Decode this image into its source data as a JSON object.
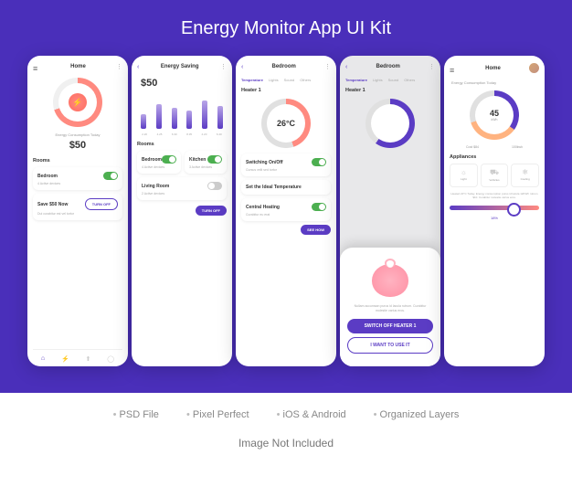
{
  "title": "Energy Monitor App UI Kit",
  "footer": {
    "feat": [
      "PSD File",
      "Pixel Perfect",
      "iOS & Android",
      "Organized Layers"
    ],
    "disclaimer": "Image Not Included"
  },
  "s1": {
    "title": "Home",
    "sub": "Energy Consumption Today",
    "price": "$50",
    "sec": "Rooms",
    "room": {
      "name": "Bedroom",
      "devices": "4 Active devices"
    },
    "save": {
      "title": "Save $50 Now",
      "sub": "Dui curabitur est vel tortor"
    },
    "turnoff": "TURN OFF"
  },
  "s2": {
    "title": "Energy Saving",
    "price": "$50",
    "sec": "Rooms",
    "rooms": [
      {
        "name": "Bedroom",
        "devices": "4 Active devices"
      },
      {
        "name": "Kitchen",
        "devices": "3 Active devices"
      },
      {
        "name": "Living Room",
        "devices": "2 Active devices"
      }
    ],
    "turnoff": "TURN OFF"
  },
  "s3": {
    "title": "Bedroom",
    "tabs": [
      "Temperature",
      "Lights",
      "Sound",
      "Others"
    ],
    "heater": "Heater 1",
    "temp": "26°C",
    "rows": [
      {
        "name": "Switching On/Off",
        "sub": "Cursus velit sed tortor"
      },
      {
        "name": "Set the Ideal Temperature",
        "sub": ""
      },
      {
        "name": "Central Heating",
        "sub": "Curabitur eu erat"
      }
    ],
    "see": "SEE HOW"
  },
  "s4": {
    "title": "Bedroom",
    "tabs": [
      "Temperature",
      "Lights",
      "Sound",
      "Others"
    ],
    "heater": "Heater 1",
    "lorem": "Nullam accumsan purus id lacula rutrum. Curabitur molestie varius eros.",
    "btn1": "SWITCH OFF HEATER 1",
    "btn2": "I WANT TO USE IT"
  },
  "s5": {
    "title": "Home",
    "sub": "Energy Consumption Today",
    "val": "45",
    "unit": "kWh",
    "stats": [
      "Cost $84",
      "100kwh"
    ],
    "sec": "Appliances",
    "appl": [
      "Light",
      "Vehicles",
      "Cooling"
    ],
    "note": "Heated 22°C Today, Energy consumption purus id lacula 12KWh rutrum $10. Curabitur molestie varius eros.",
    "pct": "18%"
  },
  "chart_data": {
    "type": "bar",
    "categories": [
      "2.20",
      "4.25",
      "6.30",
      "8.35",
      "4.20",
      "6.40"
    ],
    "values": [
      18,
      30,
      26,
      22,
      34,
      28
    ],
    "title": "Energy Saving",
    "xlabel": "",
    "ylabel": "",
    "ylim": [
      0,
      40
    ]
  }
}
